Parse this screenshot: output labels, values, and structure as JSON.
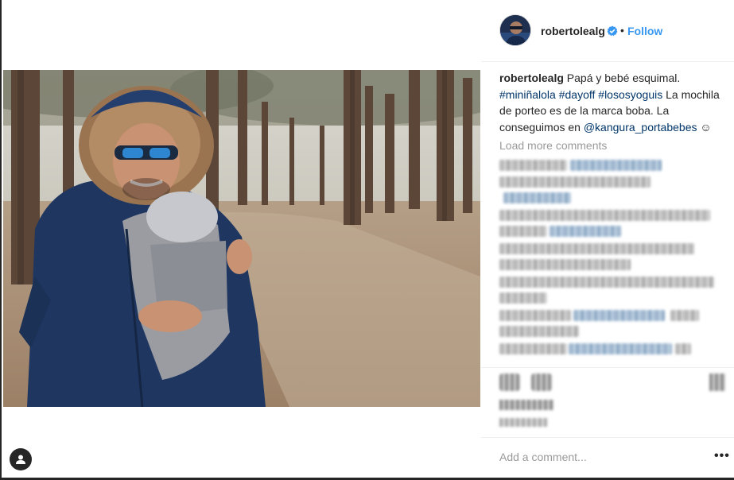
{
  "post": {
    "username": "robertolealg",
    "follow_label": "Follow",
    "separator": "•"
  },
  "caption": {
    "author": "robertolealg",
    "text_1": "Papá y bebé esquimal.",
    "tag_1": "#miniñalola",
    "tag_2": "#dayoff",
    "tag_3": "#lososyoguis",
    "text_2": "La mochila de porteo es de la marca boba. La conseguimos en",
    "mention": "@kangura_portabebes",
    "emoji": "☺"
  },
  "comments": {
    "load_more_label": "Load more comments"
  },
  "comment_box": {
    "placeholder": "Add a comment..."
  },
  "more_options": {
    "label": "•••"
  },
  "icons": {
    "verified": "verified-badge-icon",
    "tag": "user-tag-icon",
    "more": "ellipsis-icon"
  },
  "colors": {
    "link_blue": "#3897f0",
    "hashtag": "#003569",
    "muted": "#999999"
  }
}
